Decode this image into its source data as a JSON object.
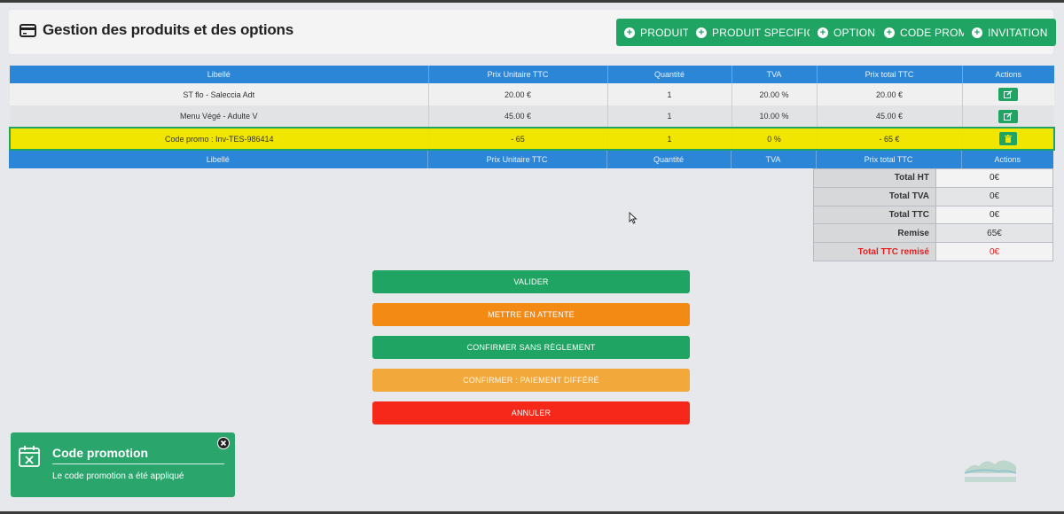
{
  "header": {
    "title": "Gestion des produits et des options",
    "buttons": [
      {
        "label": "PRODUIT"
      },
      {
        "label": "PRODUIT SPECIFIQUE"
      },
      {
        "label": "OPTION"
      },
      {
        "label": "CODE PROMO"
      },
      {
        "label": "INVITATION"
      }
    ]
  },
  "table": {
    "columns": [
      "Libellé",
      "Prix Unitaire TTC",
      "Quantité",
      "TVA",
      "Prix total TTC",
      "Actions"
    ],
    "rows": [
      {
        "libelle": "ST flo - Saleccia Adt",
        "prix_unitaire": "20.00 €",
        "quantite": "1",
        "tva": "20.00 %",
        "prix_total": "20.00 €",
        "action": "edit-icon"
      },
      {
        "libelle": "Menu Végé - Adulte V",
        "prix_unitaire": "45.00 €",
        "quantite": "1",
        "tva": "10.00 %",
        "prix_total": "45.00 €",
        "action": "edit-icon"
      },
      {
        "libelle": "Code promo : Inv-TES-986414",
        "prix_unitaire": "- 65",
        "quantite": "1",
        "tva": "0 %",
        "prix_total": "- 65 €",
        "action": "trash-icon"
      }
    ]
  },
  "totals": [
    {
      "label": "Total HT",
      "value": "0€"
    },
    {
      "label": "Total TVA",
      "value": "0€"
    },
    {
      "label": "Total TTC",
      "value": "0€"
    },
    {
      "label": "Remise",
      "value": "65€"
    },
    {
      "label": "Total TTC remisé",
      "value": "0€"
    }
  ],
  "actions": {
    "valider": "VALIDER",
    "attente": "METTRE EN ATTENTE",
    "confirmer": "CONFIRMER SANS RÈGLEMENT",
    "differe": "CONFIRMER : PAIEMENT DIFFÉRÉ",
    "annuler": "ANNULER"
  },
  "toast": {
    "title": "Code promotion",
    "message": "Le code promotion a été appliqué"
  },
  "colors": {
    "green": "#1fa463",
    "blue_header": "#2b86d8",
    "orange": "#f28a13",
    "light_orange": "#f2a83a",
    "red": "#f5281a",
    "promo_yellow": "#f1e600",
    "toast_green": "#2aa66c"
  }
}
